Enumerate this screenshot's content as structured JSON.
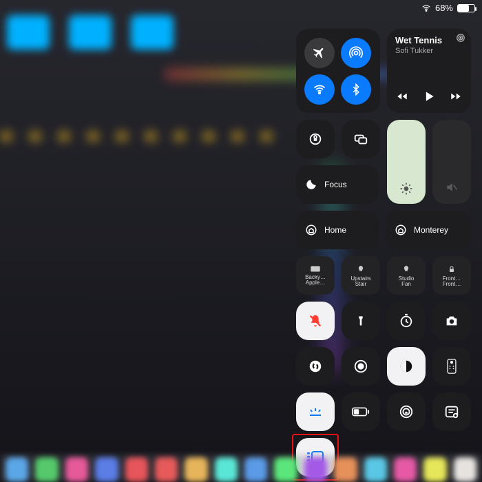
{
  "status": {
    "battery_pct": "68%",
    "wifi_on": true
  },
  "connectivity": {
    "airplane": false,
    "airdrop": true,
    "wifi": true,
    "bluetooth": true
  },
  "media": {
    "title": "Wet Tennis",
    "artist": "Sofi Tukker"
  },
  "focus": {
    "label": "Focus"
  },
  "home_tiles": {
    "home_label": "Home",
    "remote_label": "Monterey"
  },
  "accessories": [
    {
      "icon": "appletv",
      "line1": "Backy…",
      "line2": "Apple…"
    },
    {
      "icon": "lightbulb",
      "line1": "Upstairs",
      "line2": "Stair"
    },
    {
      "icon": "lightbulb",
      "line1": "Studio",
      "line2": "Fan"
    },
    {
      "icon": "lock",
      "line1": "Front…",
      "line2": "Front…"
    }
  ],
  "quick_buttons": {
    "r1": [
      "silent",
      "flashlight",
      "timer",
      "camera"
    ],
    "r2": [
      "shazam",
      "screen-record",
      "darkmode",
      "apple-tv-remote"
    ],
    "r3": [
      "keyboard-brightness",
      "battery",
      "homekit",
      "notes"
    ],
    "r4": [
      "stage-manager"
    ]
  },
  "dock_colors": [
    "#5aa6e6",
    "#55c96c",
    "#e65a9a",
    "#5a7de6",
    "#e6555a",
    "#e65a5a",
    "#e6b45a",
    "#5ae6d6",
    "#5a9ae6",
    "#5ae67a",
    "#a45ae6",
    "#e6905a",
    "#5ac7e6",
    "#e65aa5",
    "#e6e65a",
    "#e6e3df"
  ]
}
